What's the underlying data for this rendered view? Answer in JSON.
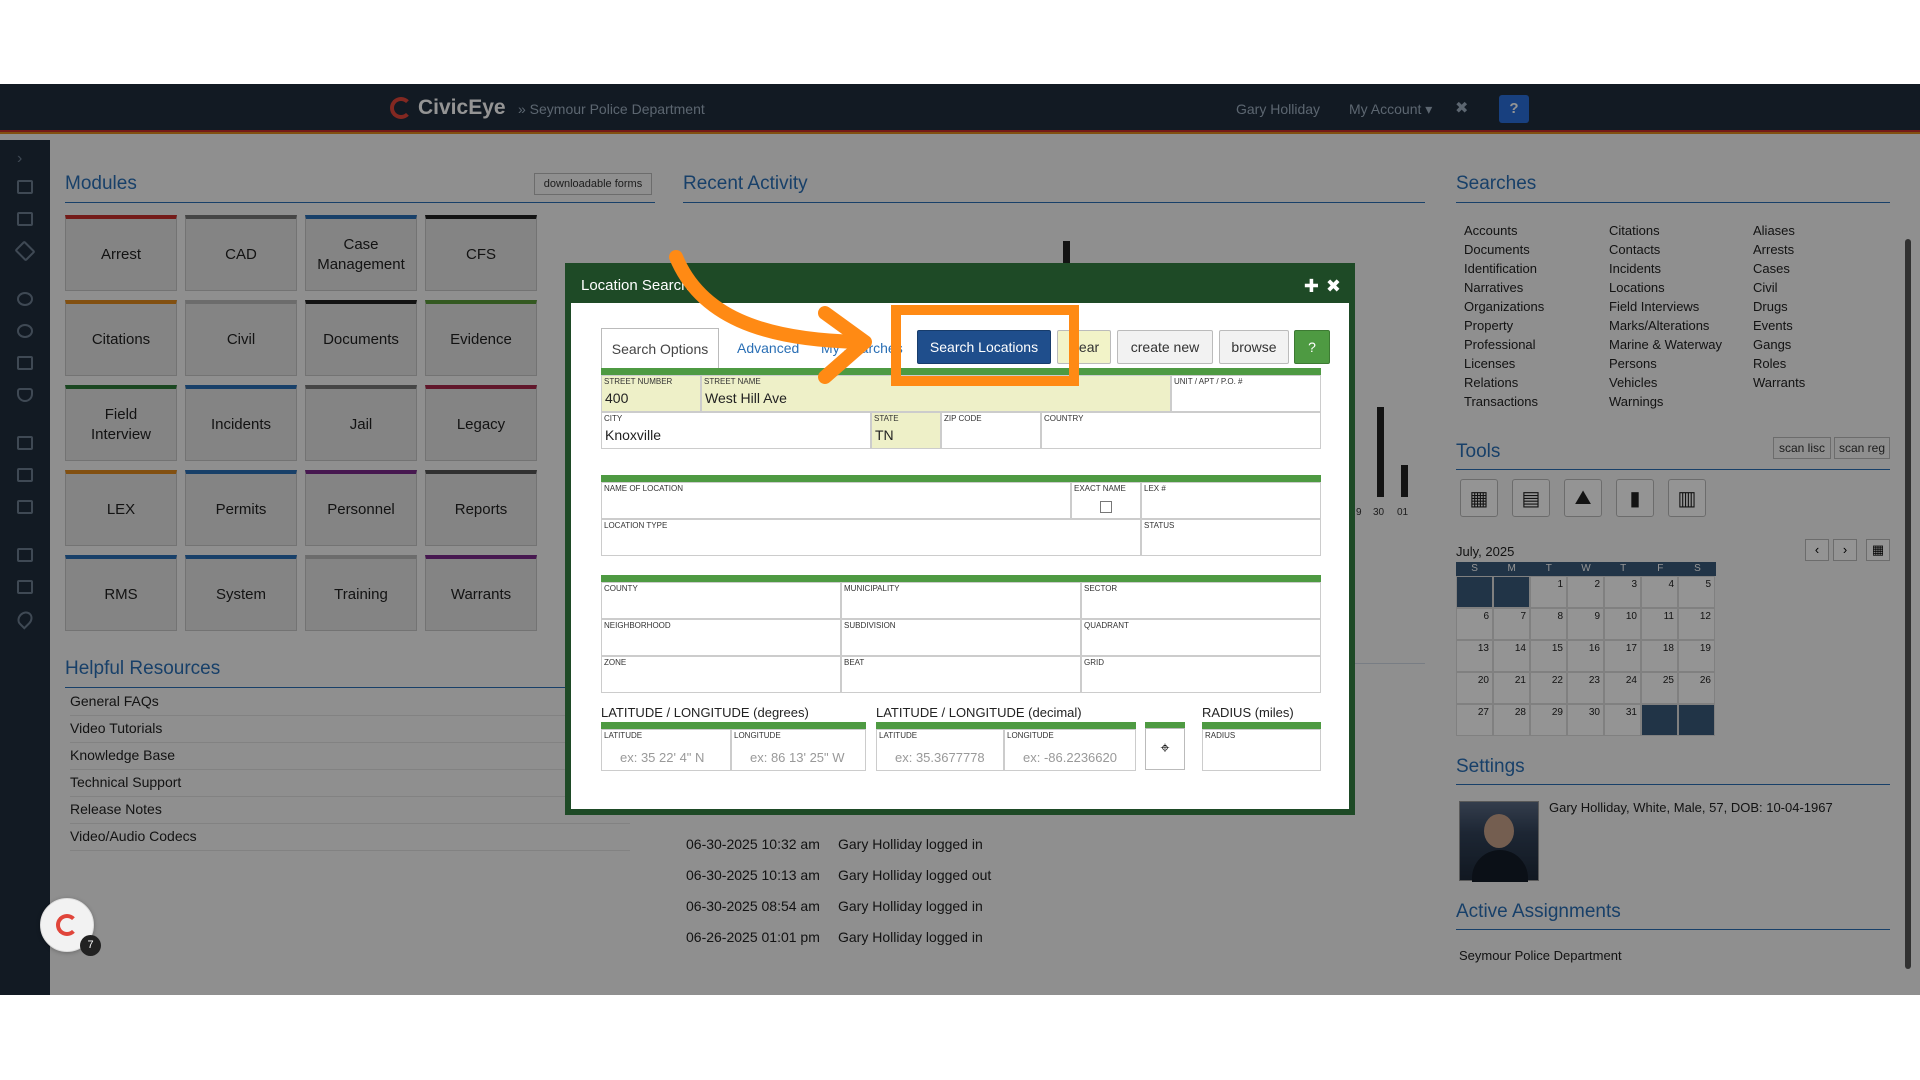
{
  "header": {
    "brand": "CivicEye",
    "department": "» Seymour Police Department",
    "user_name": "Gary Holliday",
    "my_account": "My Account ▾",
    "close_symbol": "✖",
    "help_symbol": "?"
  },
  "modules": {
    "title": "Modules",
    "downloadable_forms": "downloadable forms",
    "items": [
      {
        "label": "Arrest",
        "color": "#c9302c"
      },
      {
        "label": "CAD",
        "color": "#777777"
      },
      {
        "label": "Case\nManagement",
        "color": "#2a6fb5"
      },
      {
        "label": "CFS",
        "color": "#222222"
      },
      {
        "label": "Citations",
        "color": "#e08a1e"
      },
      {
        "label": "Civil",
        "color": "#bbbbbb"
      },
      {
        "label": "Documents",
        "color": "#222222"
      },
      {
        "label": "Evidence",
        "color": "#5a9a3a"
      },
      {
        "label": "Field\nInterview",
        "color": "#2d7a3a"
      },
      {
        "label": "Incidents",
        "color": "#2a6fb5"
      },
      {
        "label": "Jail",
        "color": "#777777"
      },
      {
        "label": "Legacy",
        "color": "#a8284a"
      },
      {
        "label": "LEX",
        "color": "#e08a1e"
      },
      {
        "label": "Permits",
        "color": "#2a6fb5"
      },
      {
        "label": "Personnel",
        "color": "#7a2a8a"
      },
      {
        "label": "Reports",
        "color": "#555555"
      },
      {
        "label": "RMS",
        "color": "#2a6fb5"
      },
      {
        "label": "System",
        "color": "#2a6fb5"
      },
      {
        "label": "Training",
        "color": "#bbbbbb"
      },
      {
        "label": "Warrants",
        "color": "#7a2a8a"
      }
    ]
  },
  "resources": {
    "title": "Helpful Resources",
    "items": [
      "General FAQs",
      "Video Tutorials",
      "Knowledge Base",
      "Technical Support",
      "Release Notes",
      "Video/Audio Codecs"
    ]
  },
  "activity": {
    "title": "Recent Activity",
    "chart_labels": [
      "9",
      "30",
      "01"
    ],
    "rows": [
      {
        "time": "06-30-2025 10:32 am",
        "text": "Gary Holliday logged in"
      },
      {
        "time": "06-30-2025 10:13 am",
        "text": "Gary Holliday logged out"
      },
      {
        "time": "06-30-2025 08:54 am",
        "text": "Gary Holliday logged in"
      },
      {
        "time": "06-26-2025 01:01 pm",
        "text": "Gary Holliday logged in"
      }
    ]
  },
  "searches": {
    "title": "Searches",
    "col1": [
      "Accounts",
      "Documents",
      "Identification",
      "Narratives",
      "Organizations",
      "Property",
      "Professional",
      "Licenses",
      "Relations",
      "Transactions"
    ],
    "col2": [
      "Citations",
      "Contacts",
      "Incidents",
      "Locations",
      "Field Interviews",
      "Marks/Alterations",
      "Marine & Waterway",
      "Persons",
      "Vehicles",
      "Warnings"
    ],
    "col3": [
      "Aliases",
      "Arrests",
      "Cases",
      "Civil",
      "Drugs",
      "Events",
      "Gangs",
      "Roles",
      "Warrants"
    ]
  },
  "tools": {
    "title": "Tools",
    "scan_lisc": "scan lisc",
    "scan_reg": "scan reg",
    "icons": [
      "calculator-icon",
      "calendar-icon",
      "map-icon",
      "document-icon",
      "notebook-icon"
    ]
  },
  "calendar": {
    "month": "July, 2025",
    "weekdays": [
      "S",
      "M",
      "T",
      "W",
      "T",
      "F",
      "S"
    ],
    "weeks": [
      [
        "",
        "",
        "1",
        "2",
        "3",
        "4",
        "5"
      ],
      [
        "6",
        "7",
        "8",
        "9",
        "10",
        "11",
        "12"
      ],
      [
        "13",
        "14",
        "15",
        "16",
        "17",
        "18",
        "19"
      ],
      [
        "20",
        "21",
        "22",
        "23",
        "24",
        "25",
        "26"
      ],
      [
        "27",
        "28",
        "29",
        "30",
        "31",
        "",
        ""
      ]
    ]
  },
  "settings": {
    "title": "Settings",
    "profile": "Gary Holliday, White, Male, 57, DOB: 10-04-1967"
  },
  "assignments": {
    "title": "Active Assignments",
    "item": "Seymour Police Department"
  },
  "modal": {
    "title": "Location Search",
    "plus_symbol": "✚",
    "close_symbol": "✖",
    "tab_search_options": "Search Options",
    "tab_advanced": "Advanced",
    "tab_my_searches": "My Searches",
    "btn_search": "Search Locations",
    "btn_clear": "clear",
    "btn_create": "create new",
    "btn_browse": "browse",
    "btn_help": "?",
    "street_number_label": "Street Number",
    "street_number": "400",
    "street_name_label": "Street Name",
    "street_name": "West Hill Ave",
    "unit_label": "Unit / Apt / P.O. #",
    "city_label": "City",
    "city": "Knoxville",
    "state_label": "State",
    "state": "TN",
    "zip_label": "Zip Code",
    "country_label": "Country",
    "name_label": "Name of Location",
    "exact_name_label": "Exact Name",
    "lex_label": "LEX #",
    "type_label": "Location Type",
    "status_label": "Status",
    "county_label": "County",
    "municipality_label": "Municipality",
    "sector_label": "Sector",
    "neighborhood_label": "Neighborhood",
    "subdivision_label": "Subdivision",
    "quadrant_label": "Quadrant",
    "zone_label": "Zone",
    "beat_label": "Beat",
    "grid_label": "Grid",
    "latlon_deg_title": "LATITUDE / LONGITUDE (degrees)",
    "latlon_dec_title": "LATITUDE / LONGITUDE (decimal)",
    "radius_title": "RADIUS (miles)",
    "lat_label": "Latitude",
    "lon_label": "Longitude",
    "radius_label": "Radius",
    "lat_deg_ph": "ex: 35 22' 4\" N",
    "lon_deg_ph": "ex: 86 13' 25\" W",
    "lat_dec_ph": "ex: 35.3677778",
    "lon_dec_ph": "ex: -86.2236620",
    "locate_symbol": "⌖"
  },
  "chat_badge": "7"
}
